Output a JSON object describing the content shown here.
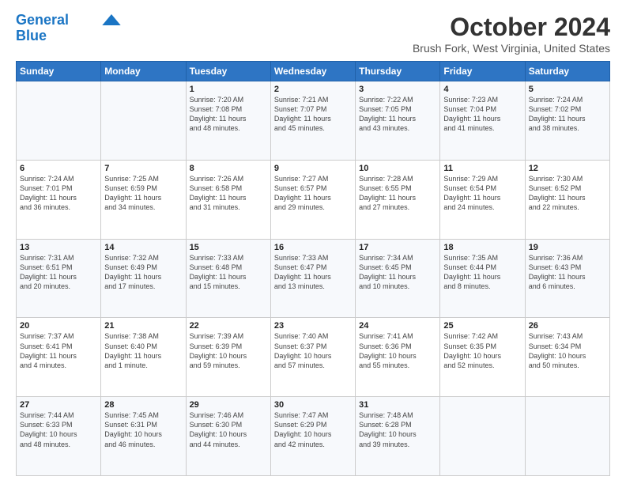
{
  "header": {
    "logo_line1": "General",
    "logo_line2": "Blue",
    "month": "October 2024",
    "location": "Brush Fork, West Virginia, United States"
  },
  "days_of_week": [
    "Sunday",
    "Monday",
    "Tuesday",
    "Wednesday",
    "Thursday",
    "Friday",
    "Saturday"
  ],
  "weeks": [
    [
      {
        "num": "",
        "info": ""
      },
      {
        "num": "",
        "info": ""
      },
      {
        "num": "1",
        "info": "Sunrise: 7:20 AM\nSunset: 7:08 PM\nDaylight: 11 hours\nand 48 minutes."
      },
      {
        "num": "2",
        "info": "Sunrise: 7:21 AM\nSunset: 7:07 PM\nDaylight: 11 hours\nand 45 minutes."
      },
      {
        "num": "3",
        "info": "Sunrise: 7:22 AM\nSunset: 7:05 PM\nDaylight: 11 hours\nand 43 minutes."
      },
      {
        "num": "4",
        "info": "Sunrise: 7:23 AM\nSunset: 7:04 PM\nDaylight: 11 hours\nand 41 minutes."
      },
      {
        "num": "5",
        "info": "Sunrise: 7:24 AM\nSunset: 7:02 PM\nDaylight: 11 hours\nand 38 minutes."
      }
    ],
    [
      {
        "num": "6",
        "info": "Sunrise: 7:24 AM\nSunset: 7:01 PM\nDaylight: 11 hours\nand 36 minutes."
      },
      {
        "num": "7",
        "info": "Sunrise: 7:25 AM\nSunset: 6:59 PM\nDaylight: 11 hours\nand 34 minutes."
      },
      {
        "num": "8",
        "info": "Sunrise: 7:26 AM\nSunset: 6:58 PM\nDaylight: 11 hours\nand 31 minutes."
      },
      {
        "num": "9",
        "info": "Sunrise: 7:27 AM\nSunset: 6:57 PM\nDaylight: 11 hours\nand 29 minutes."
      },
      {
        "num": "10",
        "info": "Sunrise: 7:28 AM\nSunset: 6:55 PM\nDaylight: 11 hours\nand 27 minutes."
      },
      {
        "num": "11",
        "info": "Sunrise: 7:29 AM\nSunset: 6:54 PM\nDaylight: 11 hours\nand 24 minutes."
      },
      {
        "num": "12",
        "info": "Sunrise: 7:30 AM\nSunset: 6:52 PM\nDaylight: 11 hours\nand 22 minutes."
      }
    ],
    [
      {
        "num": "13",
        "info": "Sunrise: 7:31 AM\nSunset: 6:51 PM\nDaylight: 11 hours\nand 20 minutes."
      },
      {
        "num": "14",
        "info": "Sunrise: 7:32 AM\nSunset: 6:49 PM\nDaylight: 11 hours\nand 17 minutes."
      },
      {
        "num": "15",
        "info": "Sunrise: 7:33 AM\nSunset: 6:48 PM\nDaylight: 11 hours\nand 15 minutes."
      },
      {
        "num": "16",
        "info": "Sunrise: 7:33 AM\nSunset: 6:47 PM\nDaylight: 11 hours\nand 13 minutes."
      },
      {
        "num": "17",
        "info": "Sunrise: 7:34 AM\nSunset: 6:45 PM\nDaylight: 11 hours\nand 10 minutes."
      },
      {
        "num": "18",
        "info": "Sunrise: 7:35 AM\nSunset: 6:44 PM\nDaylight: 11 hours\nand 8 minutes."
      },
      {
        "num": "19",
        "info": "Sunrise: 7:36 AM\nSunset: 6:43 PM\nDaylight: 11 hours\nand 6 minutes."
      }
    ],
    [
      {
        "num": "20",
        "info": "Sunrise: 7:37 AM\nSunset: 6:41 PM\nDaylight: 11 hours\nand 4 minutes."
      },
      {
        "num": "21",
        "info": "Sunrise: 7:38 AM\nSunset: 6:40 PM\nDaylight: 11 hours\nand 1 minute."
      },
      {
        "num": "22",
        "info": "Sunrise: 7:39 AM\nSunset: 6:39 PM\nDaylight: 10 hours\nand 59 minutes."
      },
      {
        "num": "23",
        "info": "Sunrise: 7:40 AM\nSunset: 6:37 PM\nDaylight: 10 hours\nand 57 minutes."
      },
      {
        "num": "24",
        "info": "Sunrise: 7:41 AM\nSunset: 6:36 PM\nDaylight: 10 hours\nand 55 minutes."
      },
      {
        "num": "25",
        "info": "Sunrise: 7:42 AM\nSunset: 6:35 PM\nDaylight: 10 hours\nand 52 minutes."
      },
      {
        "num": "26",
        "info": "Sunrise: 7:43 AM\nSunset: 6:34 PM\nDaylight: 10 hours\nand 50 minutes."
      }
    ],
    [
      {
        "num": "27",
        "info": "Sunrise: 7:44 AM\nSunset: 6:33 PM\nDaylight: 10 hours\nand 48 minutes."
      },
      {
        "num": "28",
        "info": "Sunrise: 7:45 AM\nSunset: 6:31 PM\nDaylight: 10 hours\nand 46 minutes."
      },
      {
        "num": "29",
        "info": "Sunrise: 7:46 AM\nSunset: 6:30 PM\nDaylight: 10 hours\nand 44 minutes."
      },
      {
        "num": "30",
        "info": "Sunrise: 7:47 AM\nSunset: 6:29 PM\nDaylight: 10 hours\nand 42 minutes."
      },
      {
        "num": "31",
        "info": "Sunrise: 7:48 AM\nSunset: 6:28 PM\nDaylight: 10 hours\nand 39 minutes."
      },
      {
        "num": "",
        "info": ""
      },
      {
        "num": "",
        "info": ""
      }
    ]
  ]
}
